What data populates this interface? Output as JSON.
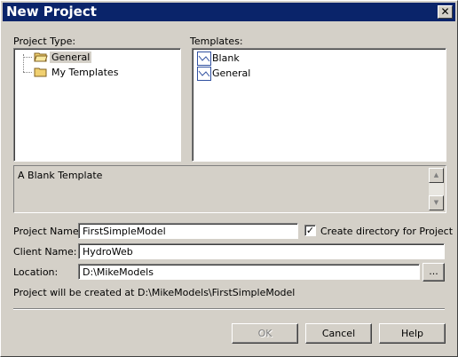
{
  "window": {
    "title": "New Project",
    "close_glyph": "✕"
  },
  "project_type": {
    "label": "Project Type:",
    "items": [
      {
        "label": "General",
        "selected": true,
        "icon": "folder-open-icon"
      },
      {
        "label": "My Templates",
        "selected": false,
        "icon": "folder-icon"
      }
    ]
  },
  "templates": {
    "label": "Templates:",
    "items": [
      {
        "label": "Blank",
        "icon": "template-icon"
      },
      {
        "label": "General",
        "icon": "template-icon"
      }
    ]
  },
  "description": {
    "text": "A Blank Template",
    "scroll_up_glyph": "▲",
    "scroll_down_glyph": "▼"
  },
  "form": {
    "project_name_label": "Project Name:",
    "project_name_value": "FirstSimpleModel",
    "create_dir_label": "Create directory for Project",
    "create_dir_checked": true,
    "create_dir_glyph": "✓",
    "client_name_label": "Client Name:",
    "client_name_value": "HydroWeb",
    "location_label": "Location:",
    "location_value": "D:\\MikeModels",
    "browse_label": "...",
    "status_text": "Project will be created at D:\\MikeModels\\FirstSimpleModel"
  },
  "buttons": {
    "ok": "OK",
    "cancel": "Cancel",
    "help": "Help"
  },
  "colors": {
    "title_bar": "#0a246a",
    "face": "#d4d0c8"
  }
}
